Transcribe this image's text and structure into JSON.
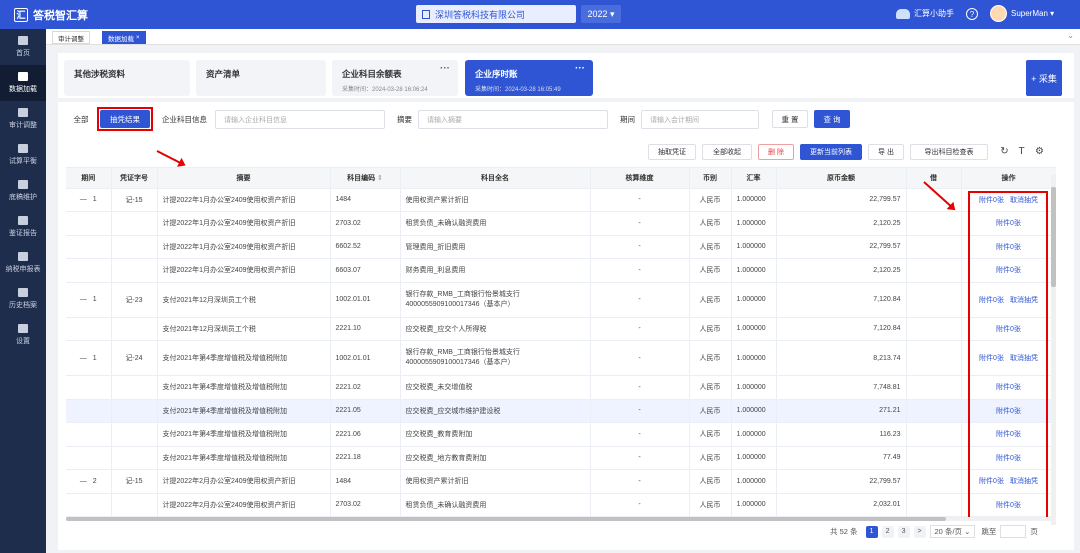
{
  "app": {
    "title": "答税智汇算",
    "logo_char": "汇",
    "company": "深圳答税科技有限公司",
    "year": "2022",
    "helper": "汇算小助手",
    "help": "?",
    "user": "SuperMan"
  },
  "sidebar": {
    "items": [
      {
        "label": "首页",
        "icon": "home-icon"
      },
      {
        "label": "数据加载",
        "icon": "database-icon"
      },
      {
        "label": "审计调整",
        "icon": "audit-icon"
      },
      {
        "label": "试算平衡",
        "icon": "balance-icon"
      },
      {
        "label": "底稿维护",
        "icon": "draft-icon"
      },
      {
        "label": "鉴证报告",
        "icon": "report-icon"
      },
      {
        "label": "纳税申报表",
        "icon": "tax-icon"
      },
      {
        "label": "历史档案",
        "icon": "archive-icon"
      },
      {
        "label": "设置",
        "icon": "settings-icon"
      }
    ]
  },
  "tabs": [
    {
      "label": "审计调整"
    },
    {
      "label": "数据加载",
      "close": "×"
    }
  ],
  "tabs_collapse": "⌄",
  "cards": [
    {
      "title": "其他涉税资料",
      "time": ""
    },
    {
      "title": "资产清单",
      "time": ""
    },
    {
      "title": "企业科目余额表",
      "time": "采集时间：2024-03-28 16:06:24",
      "dots": "···"
    },
    {
      "title": "企业序时账",
      "time": "采集时间：2024-03-28 16:05:49",
      "dots": "···"
    }
  ],
  "collect_button": "+ 采集",
  "filter": {
    "all": "全部",
    "sample": "抽凭结果",
    "subject_label": "企业科目信息",
    "subject_placeholder": "请输入企业科目信息",
    "summary_label": "摘要",
    "summary_placeholder": "请输入摘要",
    "period_label": "期间",
    "period_placeholder": "请输入会计期间",
    "reset": "重 置",
    "query": "查 询"
  },
  "toolbar": {
    "extract": "抽取凭证",
    "collapse_all": "全部收起",
    "delete": "删 除",
    "update_list": "更新当前列表",
    "export": "导 出",
    "export_check": "导出科目检查表",
    "refresh_icon": "↻",
    "text_icon": "T",
    "gear_icon": "⚙"
  },
  "table": {
    "headers": [
      "期间",
      "凭证字号",
      "摘要",
      "科目编码",
      "科目全名",
      "核算维度",
      "币别",
      "汇率",
      "原币金额",
      "借",
      "操作"
    ],
    "rows": [
      {
        "expand": "—",
        "period": "1",
        "voucher": "记-15",
        "summary": "计提2022年1月办公室2409使用权资产折旧",
        "code": "1484",
        "name": "使用权资产累计折旧",
        "dim": "-",
        "cur": "人民币",
        "rate": "1.000000",
        "amount": "22,799.57",
        "ops": [
          "附件0张",
          "取消抽凭"
        ]
      },
      {
        "expand": "",
        "period": "",
        "voucher": "",
        "summary": "计提2022年1月办公室2409使用权资产折旧",
        "code": "2703.02",
        "name": "租赁负债_未确认融资费用",
        "dim": "-",
        "cur": "人民币",
        "rate": "1.000000",
        "amount": "2,120.25",
        "ops": [
          "附件0张"
        ]
      },
      {
        "expand": "",
        "period": "",
        "voucher": "",
        "summary": "计提2022年1月办公室2409使用权资产折旧",
        "code": "6602.52",
        "name": "管理费用_折旧费用",
        "dim": "-",
        "cur": "人民币",
        "rate": "1.000000",
        "amount": "22,799.57",
        "ops": [
          "附件0张"
        ]
      },
      {
        "expand": "",
        "period": "",
        "voucher": "",
        "summary": "计提2022年1月办公室2409使用权资产折旧",
        "code": "6603.07",
        "name": "财务费用_利息费用",
        "dim": "-",
        "cur": "人民币",
        "rate": "1.000000",
        "amount": "2,120.25",
        "ops": [
          "附件0张"
        ]
      },
      {
        "expand": "—",
        "period": "1",
        "voucher": "记-23",
        "summary": "支付2021年12月深圳员工个税",
        "code": "1002.01.01",
        "name": "银行存款_RMB_工商银行怡景城支行 4000055909100017346（基本户）",
        "dim": "-",
        "cur": "人民币",
        "rate": "1.000000",
        "amount": "7,120.84",
        "ops": [
          "附件0张",
          "取消抽凭"
        ],
        "tall": true
      },
      {
        "expand": "",
        "period": "",
        "voucher": "",
        "summary": "支付2021年12月深圳员工个税",
        "code": "2221.10",
        "name": "应交税费_应交个人所得税",
        "dim": "-",
        "cur": "人民币",
        "rate": "1.000000",
        "amount": "7,120.84",
        "ops": [
          "附件0张"
        ]
      },
      {
        "expand": "—",
        "period": "1",
        "voucher": "记-24",
        "summary": "支付2021年第4季度增值税及增值税附加",
        "code": "1002.01.01",
        "name": "银行存款_RMB_工商银行怡景城支行 4000055909100017346（基本户）",
        "dim": "-",
        "cur": "人民币",
        "rate": "1.000000",
        "amount": "8,213.74",
        "ops": [
          "附件0张",
          "取消抽凭"
        ],
        "tall": true
      },
      {
        "expand": "",
        "period": "",
        "voucher": "",
        "summary": "支付2021年第4季度增值税及增值税附加",
        "code": "2221.02",
        "name": "应交税费_未交增值税",
        "dim": "-",
        "cur": "人民币",
        "rate": "1.000000",
        "amount": "7,748.81",
        "ops": [
          "附件0张"
        ]
      },
      {
        "expand": "",
        "period": "",
        "voucher": "",
        "summary": "支付2021年第4季度增值税及增值税附加",
        "code": "2221.05",
        "name": "应交税费_应交城市维护建设税",
        "dim": "-",
        "cur": "人民币",
        "rate": "1.000000",
        "amount": "271.21",
        "ops": [
          "附件0张"
        ],
        "hl": true
      },
      {
        "expand": "",
        "period": "",
        "voucher": "",
        "summary": "支付2021年第4季度增值税及增值税附加",
        "code": "2221.06",
        "name": "应交税费_教育费附加",
        "dim": "-",
        "cur": "人民币",
        "rate": "1.000000",
        "amount": "116.23",
        "ops": [
          "附件0张"
        ]
      },
      {
        "expand": "",
        "period": "",
        "voucher": "",
        "summary": "支付2021年第4季度增值税及增值税附加",
        "code": "2221.18",
        "name": "应交税费_地方教育费附加",
        "dim": "-",
        "cur": "人民币",
        "rate": "1.000000",
        "amount": "77.49",
        "ops": [
          "附件0张"
        ]
      },
      {
        "expand": "—",
        "period": "2",
        "voucher": "记-15",
        "summary": "计提2022年2月办公室2409使用权资产折旧",
        "code": "1484",
        "name": "使用权资产累计折旧",
        "dim": "-",
        "cur": "人民币",
        "rate": "1.000000",
        "amount": "22,799.57",
        "ops": [
          "附件0张",
          "取消抽凭"
        ]
      },
      {
        "expand": "",
        "period": "",
        "voucher": "",
        "summary": "计提2022年2月办公室2409使用权资产折旧",
        "code": "2703.02",
        "name": "租赁负债_未确认融资费用",
        "dim": "-",
        "cur": "人民币",
        "rate": "1.000000",
        "amount": "2,032.01",
        "ops": [
          "附件0张"
        ]
      }
    ]
  },
  "pagination": {
    "total": "共 52 条",
    "pages": [
      "1",
      "2",
      "3"
    ],
    "next": ">",
    "size": "20 条/页",
    "jump": "跳至",
    "page_unit": "页"
  }
}
